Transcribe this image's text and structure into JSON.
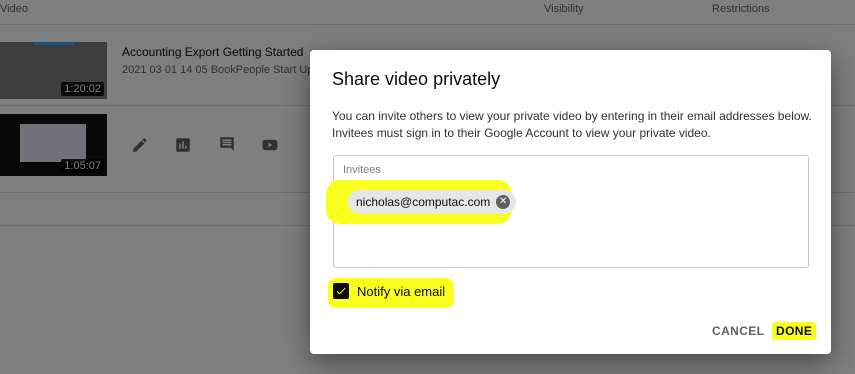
{
  "table": {
    "headers": {
      "video": "Video",
      "visibility": "Visibility",
      "restrictions": "Restrictions"
    },
    "rows": [
      {
        "title": "Accounting Export Getting Started",
        "subtitle": "2021 03 01 14 05 BookPeople Start Up",
        "duration": "1:20:02"
      },
      {
        "title": "",
        "subtitle": "",
        "duration": "1:05:07"
      }
    ],
    "row_icons": [
      "pencil-icon",
      "analytics-icon",
      "comments-icon",
      "youtube-icon"
    ]
  },
  "dialog": {
    "title": "Share video privately",
    "description": "You can invite others to view your private video by entering in their email addresses below. Invitees must sign in to their Google Account to view your private video.",
    "invitees_label": "Invitees",
    "invitees": [
      "nicholas@computac.com"
    ],
    "notify_label": "Notify via email",
    "notify_checked": true,
    "cancel_label": "CANCEL",
    "done_label": "DONE"
  },
  "colors": {
    "highlight": "#fbff1e",
    "overlay": "rgba(0,0,0,0.5)",
    "text": "#0d0d0d",
    "secondary_text": "#606060"
  }
}
